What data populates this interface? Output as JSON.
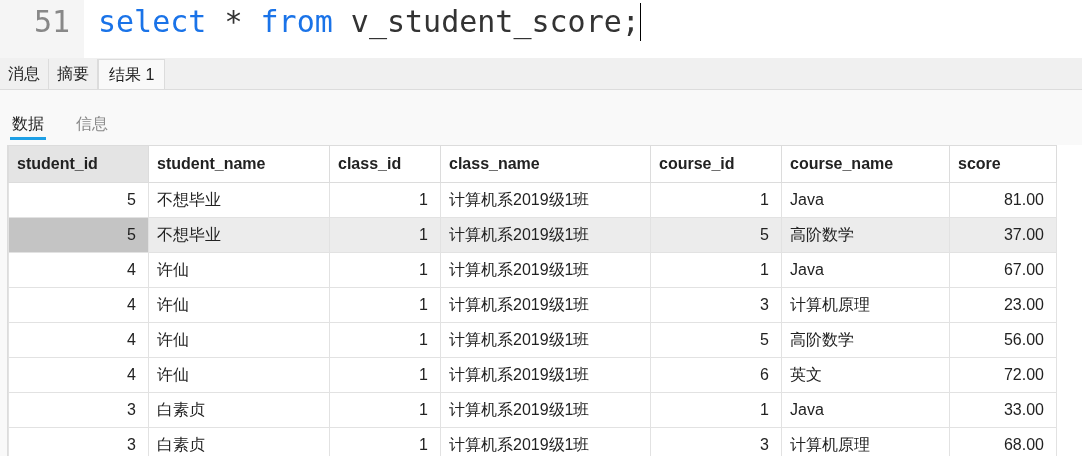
{
  "editor": {
    "line_number": "51",
    "code": [
      {
        "kind": "keyword",
        "text": "select"
      },
      {
        "kind": "plain",
        "text": " * "
      },
      {
        "kind": "keyword",
        "text": "from"
      },
      {
        "kind": "plain",
        "text": " v_student_score;"
      }
    ]
  },
  "tabs": [
    {
      "label": "消息",
      "selected": false
    },
    {
      "label": "摘要",
      "selected": false
    },
    {
      "label": "结果 1",
      "selected": true
    }
  ],
  "subtabs": [
    {
      "label": "数据",
      "selected": true
    },
    {
      "label": "信息",
      "selected": false
    }
  ],
  "table": {
    "columns": [
      {
        "label": "student_id",
        "kind": "number"
      },
      {
        "label": "student_name",
        "kind": "text"
      },
      {
        "label": "class_id",
        "kind": "number"
      },
      {
        "label": "class_name",
        "kind": "text"
      },
      {
        "label": "course_id",
        "kind": "number"
      },
      {
        "label": "course_name",
        "kind": "text"
      },
      {
        "label": "score",
        "kind": "number"
      }
    ],
    "rows": [
      {
        "selected": false,
        "cells": [
          "5",
          "不想毕业",
          "1",
          "计算机系2019级1班",
          "1",
          "Java",
          "81.00"
        ]
      },
      {
        "selected": true,
        "cells": [
          "5",
          "不想毕业",
          "1",
          "计算机系2019级1班",
          "5",
          "高阶数学",
          "37.00"
        ]
      },
      {
        "selected": false,
        "cells": [
          "4",
          "许仙",
          "1",
          "计算机系2019级1班",
          "1",
          "Java",
          "67.00"
        ]
      },
      {
        "selected": false,
        "cells": [
          "4",
          "许仙",
          "1",
          "计算机系2019级1班",
          "3",
          "计算机原理",
          "23.00"
        ]
      },
      {
        "selected": false,
        "cells": [
          "4",
          "许仙",
          "1",
          "计算机系2019级1班",
          "5",
          "高阶数学",
          "56.00"
        ]
      },
      {
        "selected": false,
        "cells": [
          "4",
          "许仙",
          "1",
          "计算机系2019级1班",
          "6",
          "英文",
          "72.00"
        ]
      },
      {
        "selected": false,
        "cells": [
          "3",
          "白素贞",
          "1",
          "计算机系2019级1班",
          "1",
          "Java",
          "33.00"
        ]
      },
      {
        "selected": false,
        "cells": [
          "3",
          "白素贞",
          "1",
          "计算机系2019级1班",
          "3",
          "计算机原理",
          "68.00"
        ]
      }
    ]
  }
}
